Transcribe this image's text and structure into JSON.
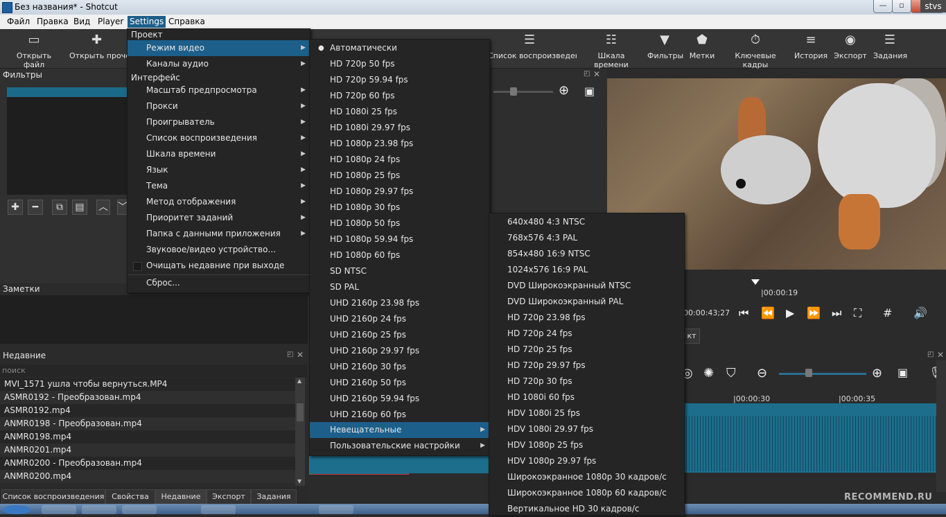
{
  "window": {
    "title": "Без названия* - Shotcut",
    "user": "stvs"
  },
  "menubar": {
    "file": "Файл",
    "edit": "Правка",
    "view": "Вид",
    "player": "Player",
    "settings": "Settings",
    "help": "Справка"
  },
  "toolbar": {
    "open_file": "Открыть файл",
    "open_other": "Открыть прочее",
    "playlist": "Список воспроизведения",
    "timeline": "Шкала времени",
    "filters": "Фильтры",
    "markers": "Метки",
    "keyframes": "Ключевые кадры",
    "history": "История",
    "export": "Экспорт",
    "jobs": "Задания"
  },
  "panels": {
    "filters": "Фильтры",
    "notes": "Заметки",
    "recent": "Недавние",
    "recent_search_placeholder": "поиск"
  },
  "recent_items": [
    "MVI_1571 ушла чтобы вернуться.MP4",
    "ASMR0192 - Преобразован.mp4",
    "ASMR0192.mp4",
    "ANMR0198 - Преобразован.mp4",
    "ANMR0198.mp4",
    "ANMR0201.mp4",
    "ANMR0200 - Преобразован.mp4",
    "ANMR0200.mp4"
  ],
  "bottom_tabs": [
    "Список воспроизведения",
    "Свойства",
    "Недавние",
    "Экспорт",
    "Задания"
  ],
  "player": {
    "timecode_marker": "|00:00:19",
    "position": "00:00:43;27",
    "tl_tick1": "|00:00:30",
    "tl_tick2": "|00:00:35",
    "partial_label": "кт"
  },
  "settings_menu": {
    "section_project": "Проект",
    "video_mode": "Режим видео",
    "audio_channels": "Каналы аудио",
    "section_interface": "Интерфейс",
    "items": [
      "Масштаб предпросмотра",
      "Прокси",
      "Проигрыватель",
      "Список воспроизведения",
      "Шкала времени",
      "Язык",
      "Тема",
      "Метод отображения",
      "Приоритет заданий",
      "Папка с данными приложения"
    ],
    "av_device": "Звуковое/видео устройство...",
    "clear_recent": "Очищать недавние при выходе",
    "reset": "Сброс..."
  },
  "video_mode_menu": {
    "items": [
      "Автоматически",
      "HD 720p 50 fps",
      "HD 720p 59.94 fps",
      "HD 720p 60 fps",
      "HD 1080i 25 fps",
      "HD 1080i 29.97 fps",
      "HD 1080p 23.98 fps",
      "HD 1080p 24 fps",
      "HD 1080p 25 fps",
      "HD 1080p 29.97 fps",
      "HD 1080p 30 fps",
      "HD 1080p 50 fps",
      "HD 1080p 59.94 fps",
      "HD 1080p 60 fps",
      "SD NTSC",
      "SD PAL",
      "UHD 2160p 23.98 fps",
      "UHD 2160p 24 fps",
      "UHD 2160p 25 fps",
      "UHD 2160p 29.97 fps",
      "UHD 2160p 30 fps",
      "UHD 2160p 50 fps",
      "UHD 2160p 59.94 fps",
      "UHD 2160p 60 fps"
    ],
    "non_broadcast": "Невещательные",
    "custom": "Пользовательские настройки"
  },
  "non_broadcast_menu": {
    "items": [
      "640x480 4:3 NTSC",
      "768x576 4:3 PAL",
      "854x480 16:9 NTSC",
      "1024x576 16:9 PAL",
      "DVD Широкоэкранный NTSC",
      "DVD Широкоэкранный PAL",
      "HD 720p 23.98 fps",
      "HD 720p 24 fps",
      "HD 720p 25 fps",
      "HD 720p 29.97 fps",
      "HD 720p 30 fps",
      "HD 1080i 60 fps",
      "HDV 1080i 25 fps",
      "HDV 1080i 29.97 fps",
      "HDV 1080p 25 fps",
      "HDV 1080p 29.97 fps",
      "Широкоэкранное 1080p 30 кадров/с",
      "Широкоэкранное 1080p 60 кадров/с",
      "Вертикальное HD 30 кадров/с"
    ]
  },
  "watermark": "RECOMMEND.RU",
  "colors": {
    "highlight": "#1c5f8a",
    "menu_bg": "#252525",
    "app_bg": "#2b2b2b"
  }
}
